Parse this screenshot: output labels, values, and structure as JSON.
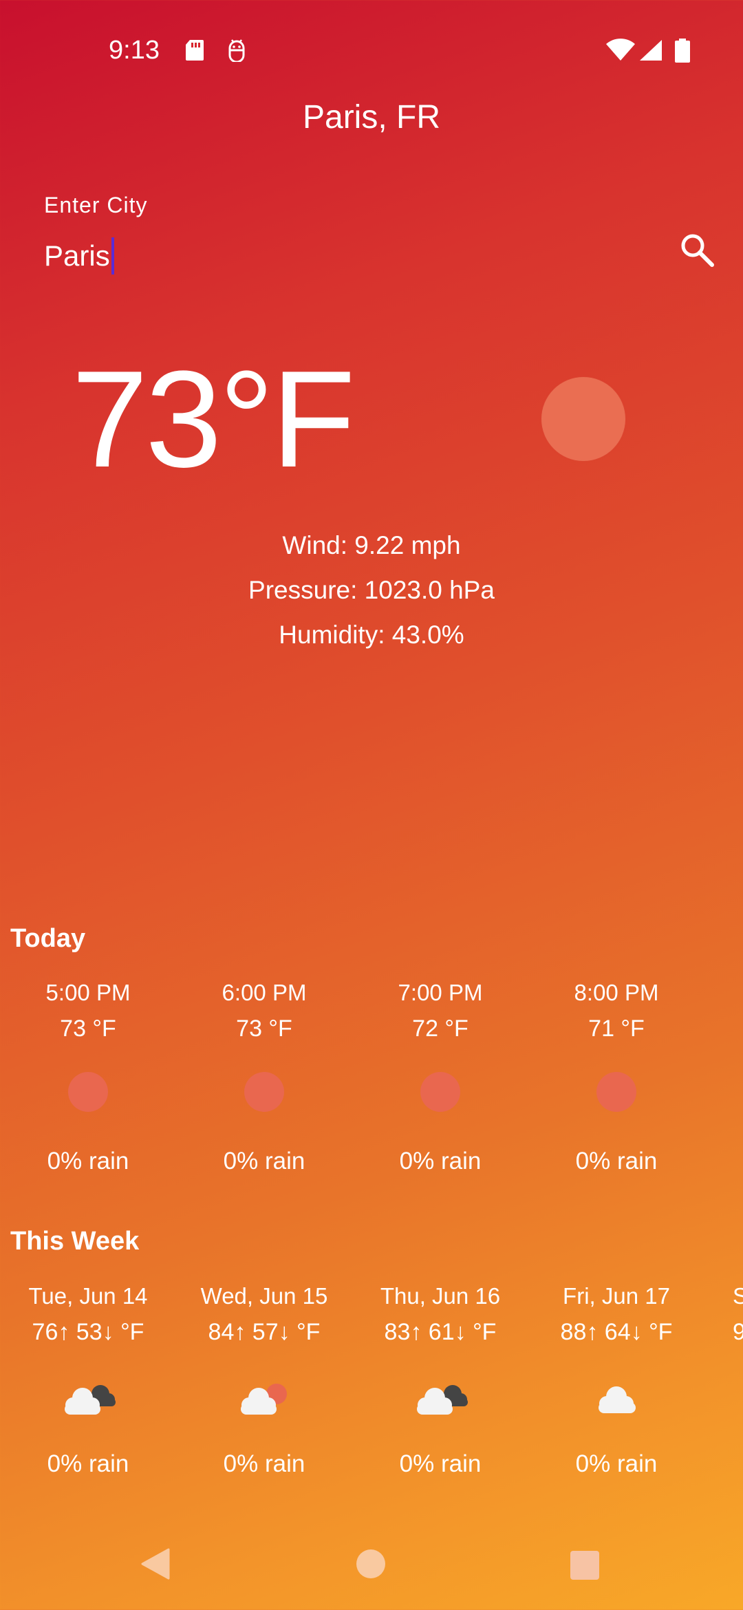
{
  "status_bar": {
    "time": "9:13",
    "icons_left": [
      "sd-card-icon",
      "android-debug-icon"
    ],
    "icons_right": [
      "wifi-icon",
      "cell-signal-icon",
      "battery-icon"
    ]
  },
  "header": {
    "title": "Paris, FR"
  },
  "search": {
    "label": "Enter City",
    "value": "Paris"
  },
  "current": {
    "temperature": "73°F",
    "icon": "sun-icon",
    "wind": "Wind: 9.22 mph",
    "pressure": "Pressure: 1023.0 hPa",
    "humidity": "Humidity: 43.0%"
  },
  "today": {
    "title": "Today",
    "hours": [
      {
        "time": "5:00 PM",
        "temp": "73 °F",
        "icon": "sun-icon",
        "rain": "0% rain"
      },
      {
        "time": "6:00 PM",
        "temp": "73 °F",
        "icon": "sun-icon",
        "rain": "0% rain"
      },
      {
        "time": "7:00 PM",
        "temp": "72 °F",
        "icon": "sun-icon",
        "rain": "0% rain"
      },
      {
        "time": "8:00 PM",
        "temp": "71 °F",
        "icon": "sun-icon",
        "rain": "0% rain"
      }
    ]
  },
  "week": {
    "title": "This Week",
    "days": [
      {
        "date": "Tue, Jun 14",
        "temps": "76↑ 53↓ °F",
        "icon": "broken-clouds-icon",
        "rain": "0% rain"
      },
      {
        "date": "Wed, Jun 15",
        "temps": "84↑ 57↓ °F",
        "icon": "partly-cloudy-icon",
        "rain": "0% rain"
      },
      {
        "date": "Thu, Jun 16",
        "temps": "83↑ 61↓ °F",
        "icon": "broken-clouds-icon",
        "rain": "0% rain"
      },
      {
        "date": "Fri, Jun 17",
        "temps": "88↑ 64↓ °F",
        "icon": "cloud-icon",
        "rain": "0% rain"
      }
    ],
    "partial_next": {
      "date": "S",
      "temps": "9"
    }
  },
  "nav": {
    "back": "back-icon",
    "home": "home-icon",
    "recents": "recents-icon"
  }
}
